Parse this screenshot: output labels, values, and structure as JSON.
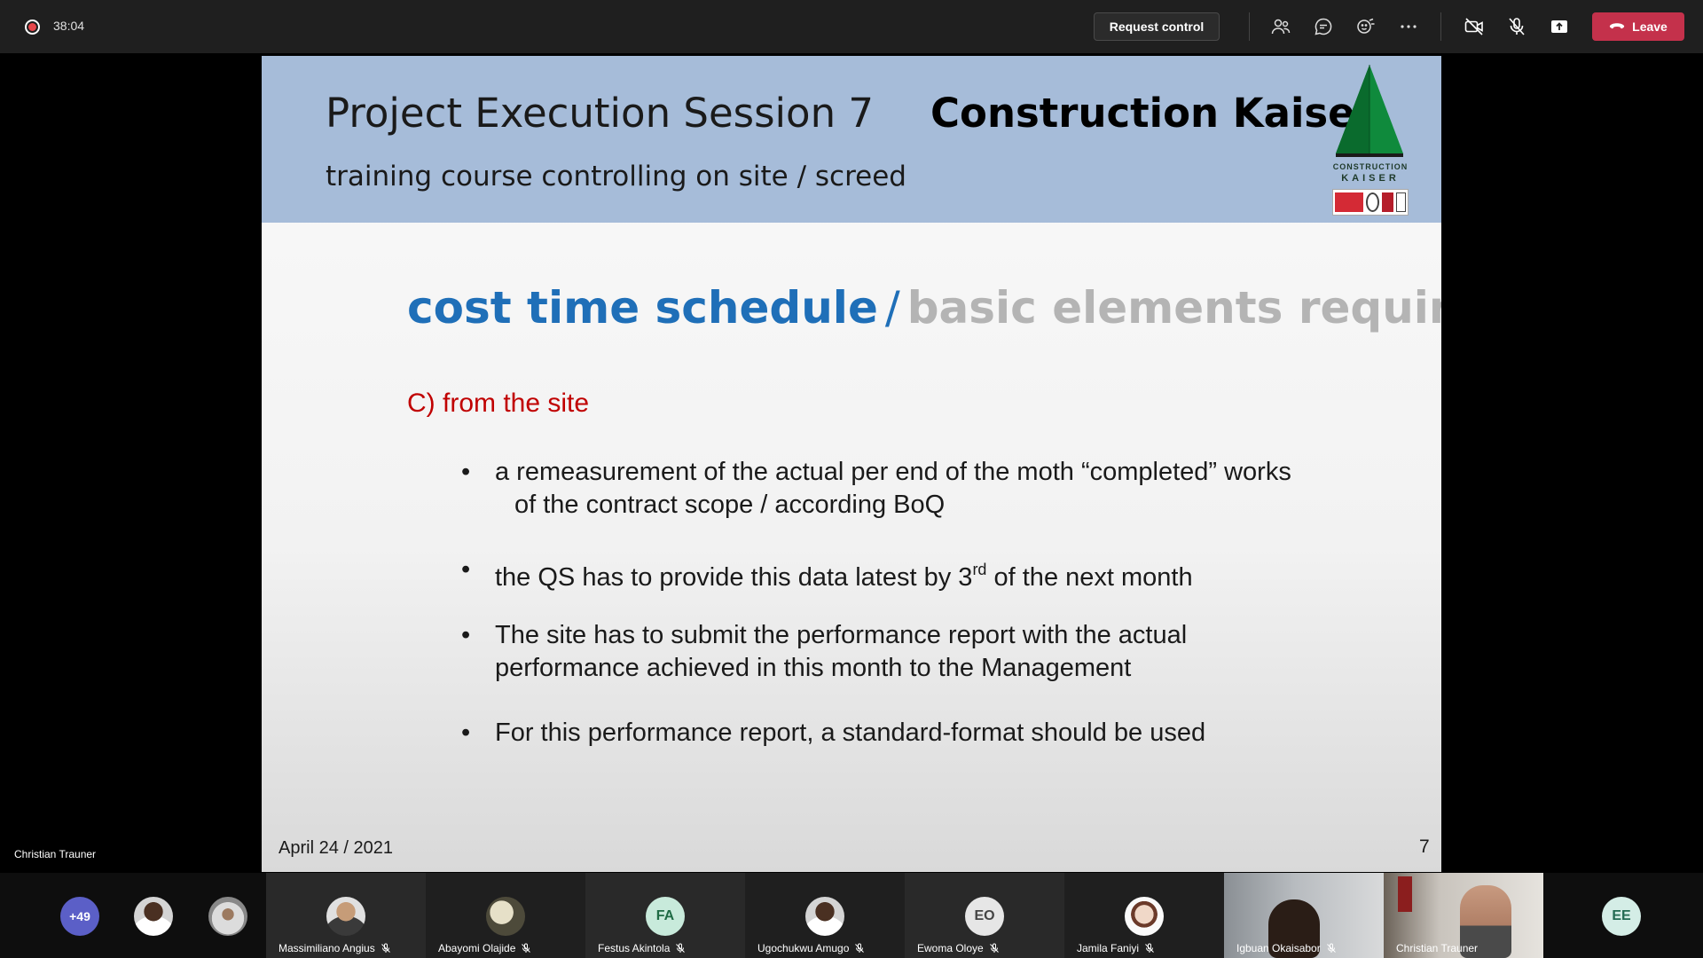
{
  "toolbar": {
    "timer": "38:04",
    "request_control_label": "Request control",
    "leave_label": "Leave",
    "colors": {
      "leave": "#c4314b",
      "recording": "#e8474b"
    },
    "icons": [
      "participants-icon",
      "chat-icon",
      "reactions-icon",
      "more-options-icon",
      "camera-off-icon",
      "mic-off-icon",
      "share-screen-icon",
      "phone-hangup-icon"
    ]
  },
  "stage": {
    "presenter_name": "Christian Trauner"
  },
  "slide": {
    "session_title": "Project Execution Session 7",
    "company_name": "Construction Kaiser",
    "subtitle": "training course controlling on site / screed",
    "logo_line1": "CONSTRUCTION",
    "logo_line2": "KAISER",
    "heading_main": "cost time schedule",
    "heading_separator": "/",
    "heading_secondary": "basic elements required",
    "section_label": "C) from the site",
    "bullet_symbol": "•",
    "bullets": [
      {
        "line1": "a remeasurement of the actual per end of the moth “completed” works",
        "line2": "of the contract scope / according BoQ"
      },
      {
        "before": "the QS has to provide this data latest by 3",
        "sup": "rd",
        "after": " of the next month"
      },
      {
        "line1": "The site has to submit the performance report with the actual",
        "line2": "performance achieved in this month to the Management"
      },
      {
        "line1": "For this performance report, a standard-format should be used"
      }
    ],
    "date": "April 24 / 2021",
    "page_number": "7",
    "colors": {
      "header_bg": "#a6bcd9",
      "heading_blue": "#1f6fb8",
      "heading_gray": "#b4b4b4",
      "section_red": "#c00000"
    }
  },
  "participants": {
    "overflow_count": "+49",
    "tiles": [
      {
        "name": "Massimiliano Angius"
      },
      {
        "name": "Abayomi Olajide"
      },
      {
        "name": "Festus Akintola",
        "initials": "FA"
      },
      {
        "name": "Ugochukwu Amugo"
      },
      {
        "name": "Ewoma Oloye",
        "initials": "EO"
      },
      {
        "name": "Jamila Faniyi"
      },
      {
        "name": "Igbuan Okaisabor"
      },
      {
        "name": "Christian Trauner"
      }
    ],
    "last_initials": "EE"
  }
}
